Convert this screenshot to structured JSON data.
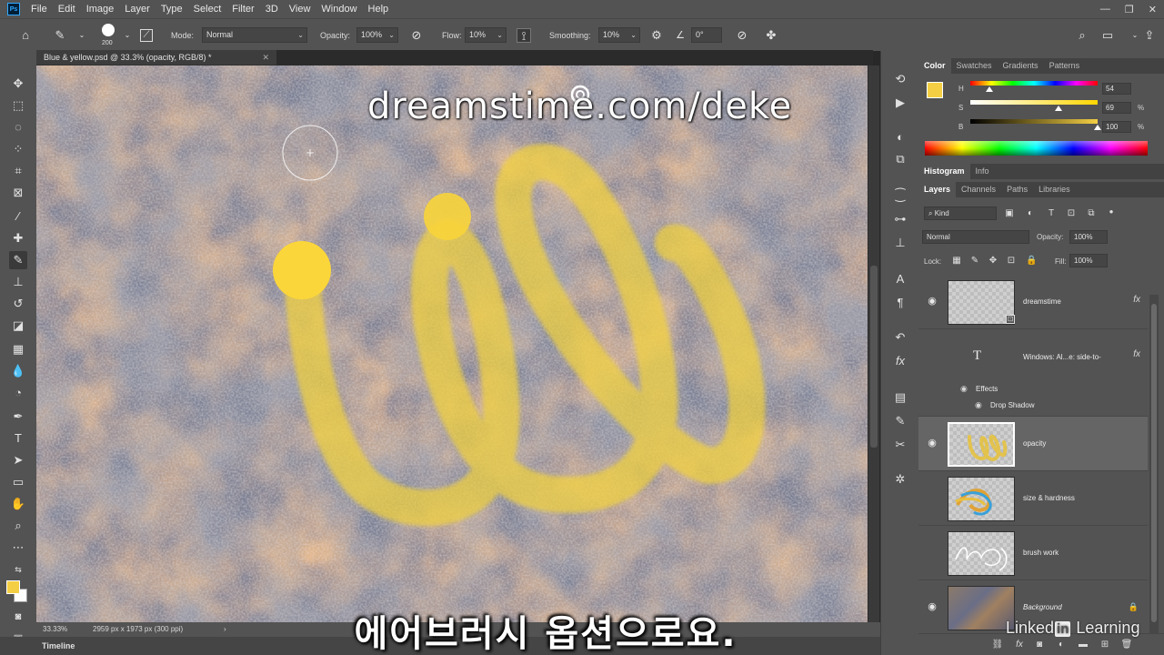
{
  "menu": {
    "items": [
      "File",
      "Edit",
      "Image",
      "Layer",
      "Type",
      "Select",
      "Filter",
      "3D",
      "View",
      "Window",
      "Help"
    ]
  },
  "options": {
    "brush_size": "200",
    "mode_label": "Mode:",
    "mode_value": "Normal",
    "opacity_label": "Opacity:",
    "opacity_value": "100%",
    "flow_label": "Flow:",
    "flow_value": "10%",
    "smoothing_label": "Smoothing:",
    "smoothing_value": "10%",
    "angle_value": "0°"
  },
  "document": {
    "tab_title": "Blue & yellow.psd @ 33.3% (opacity, RGB/8) *",
    "zoom": "33.33%",
    "dimensions": "2959 px x 1973 px (300 ppi)",
    "watermark": "dreamstime.com/deke"
  },
  "timeline": {
    "label": "Timeline"
  },
  "color_panel": {
    "tabs": [
      "Color",
      "Swatches",
      "Gradients",
      "Patterns"
    ],
    "foreground": "#f4cf44",
    "h_label": "H",
    "h_value": "54",
    "h_pos": 0.15,
    "s_label": "S",
    "s_value": "69",
    "s_pos": 0.69,
    "s_unit": "%",
    "b_label": "B",
    "b_value": "100",
    "b_pos": 1.0,
    "b_unit": "%"
  },
  "histogram_tabs": [
    "Histogram",
    "Info"
  ],
  "layers_panel": {
    "tabs": [
      "Layers",
      "Channels",
      "Paths",
      "Libraries"
    ],
    "filter_kind": "Kind",
    "blend_mode": "Normal",
    "opacity_label": "Opacity:",
    "opacity_value": "100%",
    "lock_label": "Lock:",
    "fill_label": "Fill:",
    "fill_value": "100%",
    "layers": [
      {
        "name": "dreamstime",
        "visible": true,
        "fx": "fx"
      },
      {
        "name": "Windows: Al...e: side-to-",
        "visible": false,
        "fx": "fx"
      },
      {
        "name": "Effects"
      },
      {
        "name": "Drop Shadow"
      },
      {
        "name": "opacity",
        "visible": true,
        "selected": true
      },
      {
        "name": "size & hardness",
        "visible": false
      },
      {
        "name": "brush work",
        "visible": false
      },
      {
        "name": "Background",
        "visible": true
      }
    ]
  },
  "subtitle": "에어브러시 옵션으로요.",
  "branding": {
    "prefix": "Linked",
    "badge": "in",
    "suffix": " Learning"
  }
}
